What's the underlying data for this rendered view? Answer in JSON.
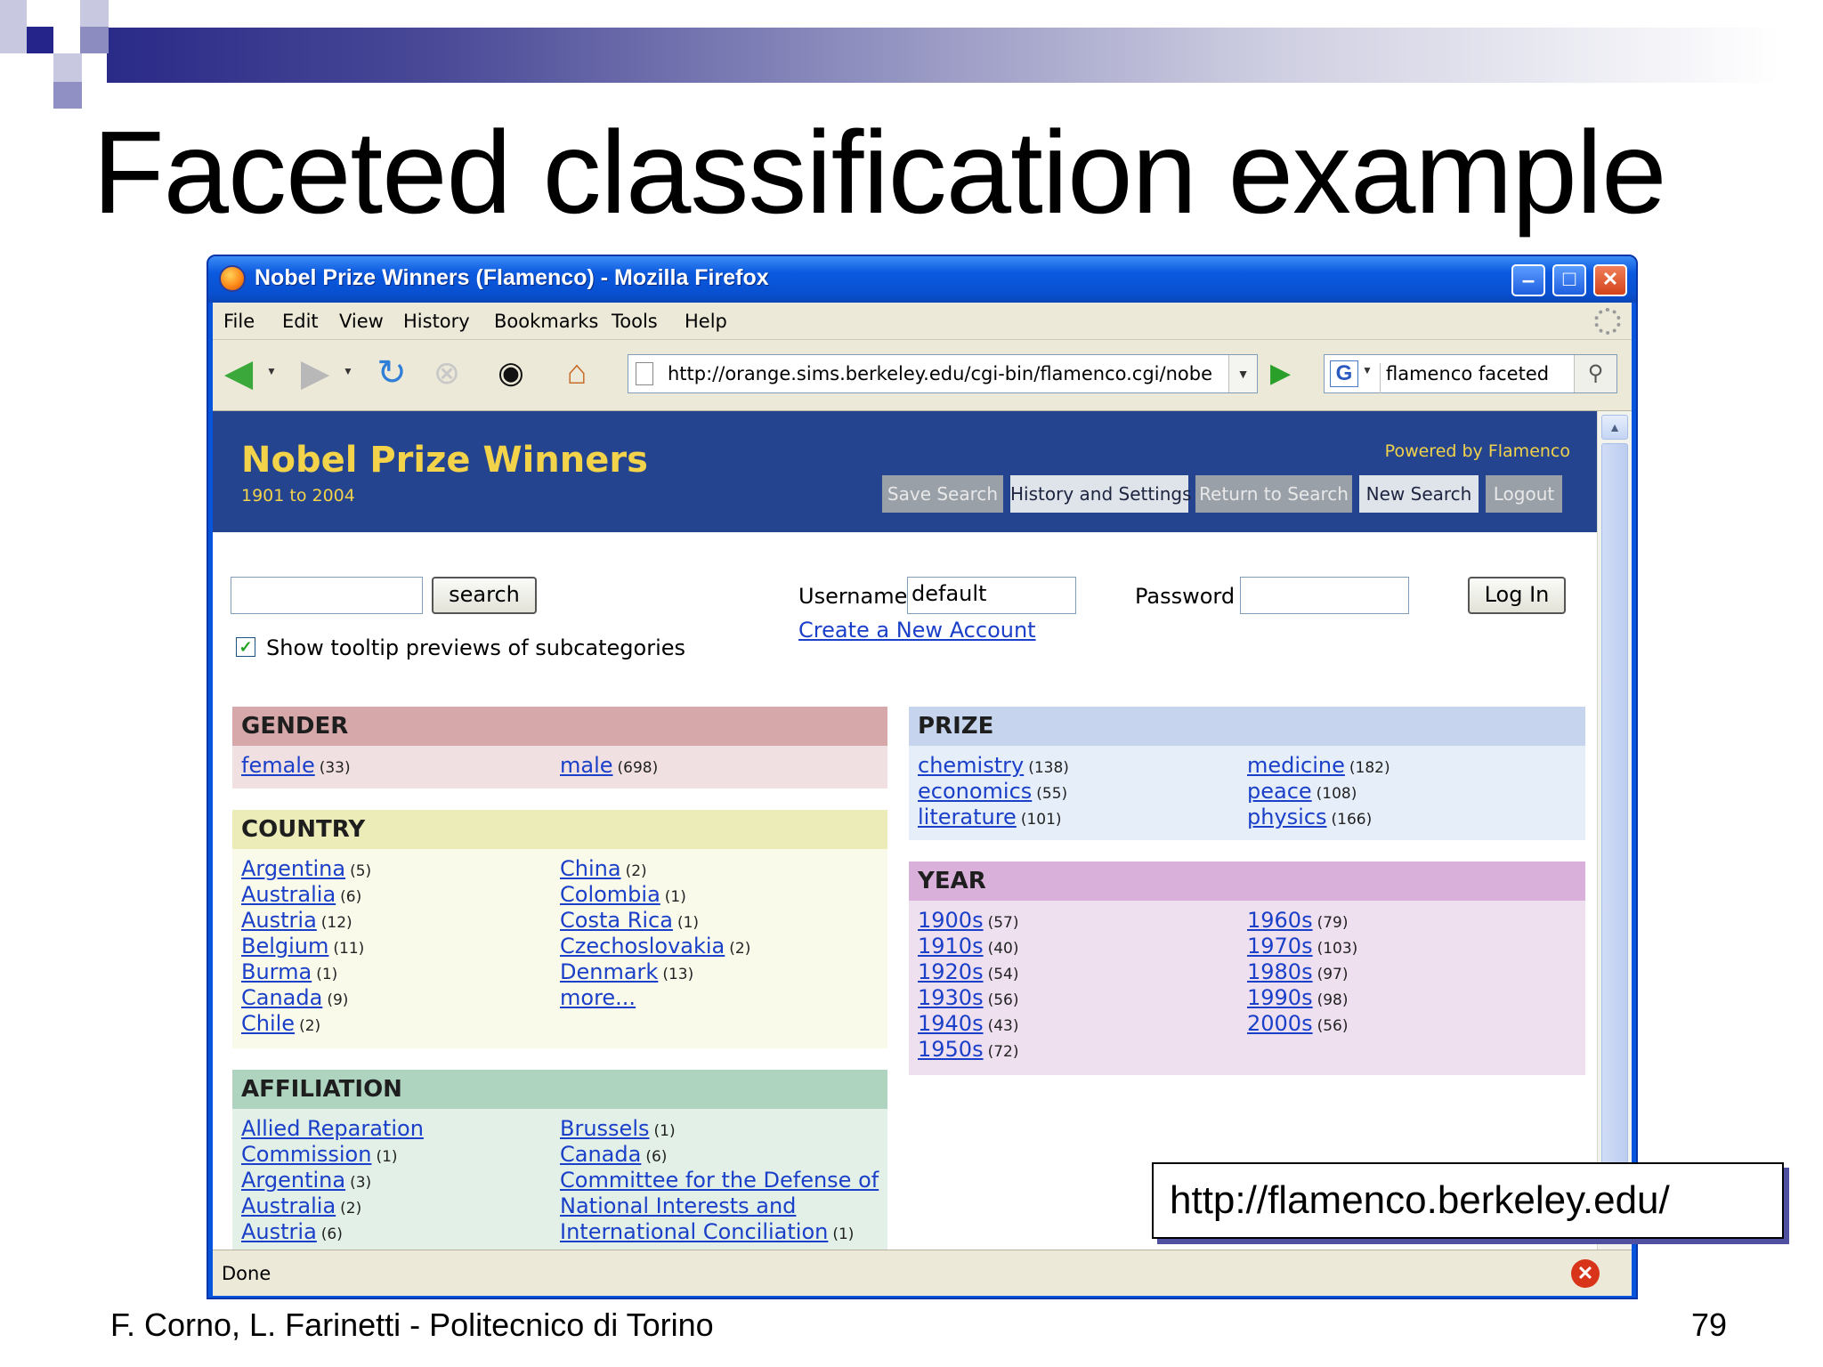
{
  "slide": {
    "title": "Faceted classification example",
    "footer_left": "F. Corno, L. Farinetti - Politecnico di Torino",
    "page_number": "79",
    "url_callout": "http://flamenco.berkeley.edu/",
    "accent_color": "#2a2a88"
  },
  "window": {
    "title": "Nobel Prize Winners (Flamenco) - Mozilla Firefox",
    "minimize": "–",
    "maximize": "□",
    "close": "✕"
  },
  "menu": [
    "File",
    "Edit",
    "View",
    "History",
    "Bookmarks",
    "Tools",
    "Help"
  ],
  "toolbar": {
    "url": "http://orange.sims.berkeley.edu/cgi-bin/flamenco.cgi/nobel/Flamenco",
    "search_engine_icon": "G",
    "search_text": "flamenco faceted",
    "icons": [
      "back-icon",
      "forward-icon",
      "reload-icon",
      "stop-icon",
      "eye-icon",
      "home-icon"
    ]
  },
  "status": {
    "text": "Done"
  },
  "flamenco": {
    "title": "Nobel Prize Winners",
    "subtitle": "1901 to 2004",
    "powered": "Powered by Flamenco",
    "buttons": [
      "Save Search",
      "History and Settings",
      "Return to Search",
      "New Search",
      "Logout"
    ],
    "search_button": "search",
    "username_label": "Username",
    "username_value": "default",
    "create_account": "Create a New Account",
    "password_label": "Password",
    "login_button": "Log In",
    "tooltip_label": "Show tooltip previews of subcategories",
    "tooltip_checked": true,
    "colors": {
      "header_bg": "#244490",
      "title_yellow": "#f2d34a",
      "gender_head": "#d6a8aa",
      "gender_body": "#f0e0e2",
      "country_head": "#ececb8",
      "country_body": "#fafaea",
      "affiliation_head": "#aed4c0",
      "affiliation_body": "#e2f0e8",
      "prize_head": "#c6d4ee",
      "prize_body": "#e6eef9",
      "year_head": "#d8b0da",
      "year_body": "#efe0f0"
    }
  },
  "facets": {
    "gender": {
      "head": "GENDER",
      "col1": [
        {
          "label": "female",
          "count": "(33)"
        }
      ],
      "col2": [
        {
          "label": "male",
          "count": "(698)"
        }
      ]
    },
    "country": {
      "head": "COUNTRY",
      "col1": [
        {
          "label": "Argentina",
          "count": "(5)"
        },
        {
          "label": "Australia",
          "count": "(6)"
        },
        {
          "label": "Austria",
          "count": "(12)"
        },
        {
          "label": "Belgium",
          "count": "(11)"
        },
        {
          "label": "Burma",
          "count": "(1)"
        },
        {
          "label": "Canada",
          "count": "(9)"
        },
        {
          "label": "Chile",
          "count": "(2)"
        }
      ],
      "col2": [
        {
          "label": "China",
          "count": "(2)"
        },
        {
          "label": "Colombia",
          "count": "(1)"
        },
        {
          "label": "Costa Rica",
          "count": "(1)"
        },
        {
          "label": "Czechoslovakia",
          "count": "(2)"
        },
        {
          "label": "Denmark",
          "count": "(13)"
        },
        {
          "label": "more...",
          "count": ""
        }
      ]
    },
    "affiliation": {
      "head": "AFFILIATION",
      "col1": [
        {
          "label": "Allied Reparation",
          "count": ""
        },
        {
          "label": "Commission",
          "count": "(1)"
        },
        {
          "label": "Argentina",
          "count": "(3)"
        },
        {
          "label": "Australia",
          "count": "(2)"
        },
        {
          "label": "Austria",
          "count": "(6)"
        }
      ],
      "col2": [
        {
          "label": "Brussels",
          "count": "(1)"
        },
        {
          "label": "Canada",
          "count": "(6)"
        },
        {
          "label": "Committee for the Defense of",
          "count": ""
        },
        {
          "label": "National Interests and",
          "count": ""
        },
        {
          "label": "International Conciliation",
          "count": "(1)"
        }
      ]
    },
    "prize": {
      "head": "PRIZE",
      "col1": [
        {
          "label": "chemistry",
          "count": "(138)"
        },
        {
          "label": "economics",
          "count": "(55)"
        },
        {
          "label": "literature",
          "count": "(101)"
        }
      ],
      "col2": [
        {
          "label": "medicine",
          "count": "(182)"
        },
        {
          "label": "peace",
          "count": "(108)"
        },
        {
          "label": "physics",
          "count": "(166)"
        }
      ]
    },
    "year": {
      "head": "YEAR",
      "col1": [
        {
          "label": "1900s",
          "count": "(57)"
        },
        {
          "label": "1910s",
          "count": "(40)"
        },
        {
          "label": "1920s",
          "count": "(54)"
        },
        {
          "label": "1930s",
          "count": "(56)"
        },
        {
          "label": "1940s",
          "count": "(43)"
        },
        {
          "label": "1950s",
          "count": "(72)"
        }
      ],
      "col2": [
        {
          "label": "1960s",
          "count": "(79)"
        },
        {
          "label": "1970s",
          "count": "(103)"
        },
        {
          "label": "1980s",
          "count": "(97)"
        },
        {
          "label": "1990s",
          "count": "(98)"
        },
        {
          "label": "2000s",
          "count": "(56)"
        }
      ]
    }
  }
}
